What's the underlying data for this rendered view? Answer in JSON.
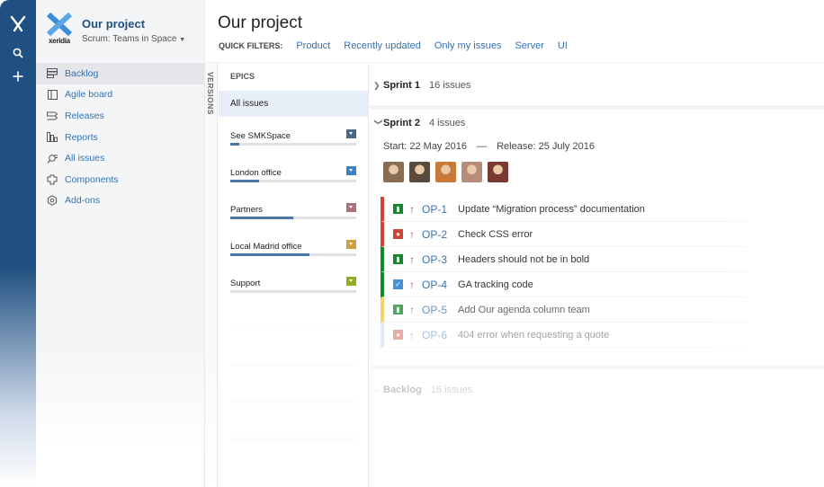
{
  "global_nav": {
    "icons": [
      "atlassian-logo-icon",
      "search-icon",
      "plus-icon"
    ]
  },
  "project": {
    "logo_text": "xeridia",
    "title": "Our project",
    "subtitle": "Scrum: Teams in Space"
  },
  "sidebar": {
    "items": [
      {
        "label": "Backlog",
        "icon": "backlog-icon",
        "active": true
      },
      {
        "label": "Agile board",
        "icon": "board-icon"
      },
      {
        "label": "Releases",
        "icon": "releases-icon"
      },
      {
        "label": "Reports",
        "icon": "reports-icon"
      },
      {
        "label": "All issues",
        "icon": "issues-icon"
      },
      {
        "label": "Components",
        "icon": "components-icon"
      },
      {
        "label": "Add-ons",
        "icon": "addons-icon"
      }
    ]
  },
  "versions_tab": "VERSIONS",
  "header": {
    "title": "Our project",
    "quick_filters_label": "QUICK FILTERS:",
    "quick_filters": [
      "Product",
      "Recently updated",
      "Only my issues",
      "Server",
      "UI"
    ]
  },
  "epics": {
    "heading": "EPICS",
    "all_label": "All issues",
    "items": [
      {
        "name": "See SMKSpace",
        "color": "#4a6785",
        "progress": 0.07
      },
      {
        "name": "London office",
        "color": "#3b7fc4",
        "progress": 0.23
      },
      {
        "name": "Partners",
        "color": "#ac707a",
        "progress": 0.5
      },
      {
        "name": "Local Madrid office",
        "color": "#d39c3f",
        "progress": 0.63
      },
      {
        "name": "Support",
        "color": "#8eb021",
        "progress": 0
      }
    ]
  },
  "sprints": {
    "sprint1": {
      "name": "Sprint 1",
      "count": "16 issues"
    },
    "sprint2": {
      "name": "Sprint 2",
      "count": "4 issues",
      "start_label": "Start:",
      "start_date": "22 May 2016",
      "dash": "—",
      "release_label": "Release:",
      "release_date": "25 July 2016",
      "avatars": [
        "#8a6e54",
        "#5a4a3c",
        "#c77a3a",
        "#b58d78",
        "#7a3a32"
      ]
    },
    "backlog": {
      "name": "Backlog",
      "count": "16 issues"
    },
    "issues": [
      {
        "key": "OP-1",
        "summary": "Update “Migration process” documentation",
        "type": "story",
        "type_color": "#14892c",
        "border": "#d04437"
      },
      {
        "key": "OP-2",
        "summary": "Check CSS error",
        "type": "bug",
        "type_color": "#d04437",
        "border": "#d04437"
      },
      {
        "key": "OP-3",
        "summary": "Headers should not be in bold",
        "type": "story",
        "type_color": "#14892c",
        "border": "#14892c"
      },
      {
        "key": "OP-4",
        "summary": "GA tracking code",
        "type": "task",
        "type_color": "#4a90d9",
        "border": "#14892c"
      },
      {
        "key": "OP-5",
        "summary": "Add Our agenda column team",
        "type": "story",
        "type_color": "#14892c",
        "border": "#f6c342"
      },
      {
        "key": "OP-6",
        "summary": "404 error when requesting a quote",
        "type": "bug",
        "type_color": "#d04437",
        "border": "#bcd4ef"
      }
    ]
  }
}
